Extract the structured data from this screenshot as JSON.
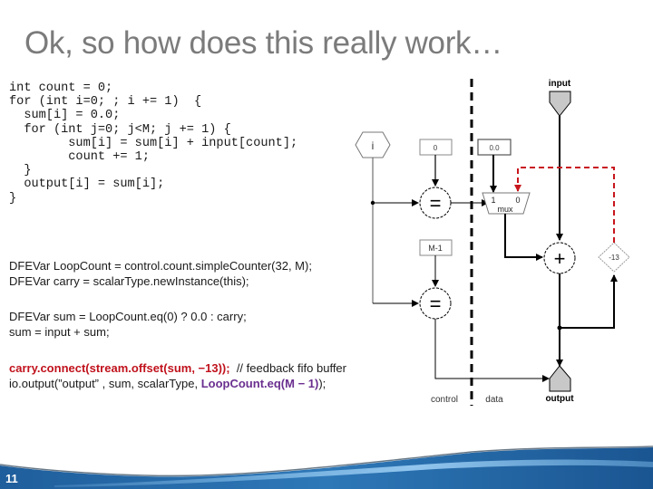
{
  "slide": {
    "title": "Ok, so how does this really work…",
    "page_number": "11"
  },
  "code_c": {
    "lines": [
      "int count = 0;",
      "for (int i=0; ; i += 1)  {",
      "  sum[i] = 0.0;",
      "  for (int j=0; j<M; j += 1) {",
      "        sum[i] = sum[i] + input[count];",
      "        count += 1;",
      "  }",
      "  output[i] = sum[i];",
      "}"
    ]
  },
  "code_java": {
    "para1": [
      "DFEVar LoopCount = control.count.simpleCounter(32, M);",
      "DFEVar carry = scalarType.newInstance(this);"
    ],
    "para2": [
      "DFEVar sum = LoopCount.eq(0) ? 0.0 : carry;",
      "sum = input + sum;"
    ],
    "para3_line1_red": "carry.connect(stream.offset(sum, −13));",
    "para3_line1_comment": "  // feedback fifo buffer",
    "para3_line2_prefix": "io.output(”output” , sum, scalarType, ",
    "para3_line2_purple": "LoopCount.eq(M − 1)",
    "para3_line2_suffix": ");"
  },
  "diagram": {
    "counter_label": "i",
    "const_zero": "0",
    "const_zero_float": "0.0",
    "const_m_minus_1": "M-1",
    "eq_symbol": "=",
    "add_symbol": "+",
    "mux_label": "mux",
    "mux_in1": "1",
    "mux_in0": "0",
    "offset_label": "-13",
    "input_label": "input",
    "output_label": "output",
    "control_label": "control",
    "data_label": "data",
    "colors": {
      "feedback": "#c8161d",
      "io_fill": "#c8c8c8",
      "wave_dark": "#1d5b97",
      "wave_light": "#6fb2e6"
    }
  }
}
